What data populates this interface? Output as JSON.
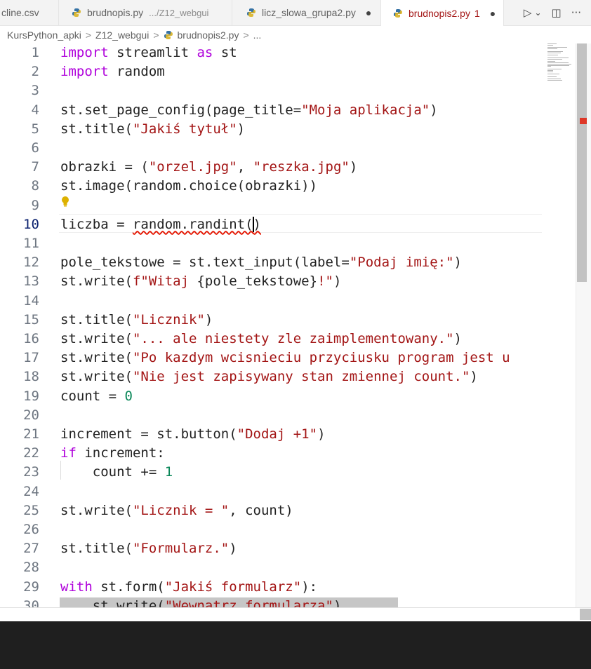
{
  "tabs": [
    {
      "name": "cline.csv",
      "active": false
    },
    {
      "name": "brudnopis.py",
      "desc": ".../Z12_webgui",
      "active": false
    },
    {
      "name": "licz_slowa_grupa2.py",
      "modified": true,
      "active": false
    },
    {
      "name": "brudnopis2.py",
      "problems": "1",
      "modified": true,
      "active": true
    }
  ],
  "tab_dot": "●",
  "actions": {
    "run": "▷",
    "run_menu": "⌄",
    "split": "◫",
    "more": "···"
  },
  "breadcrumb": [
    "KursPython_apki",
    "Z12_webgui",
    "brudnopis2.py",
    "..."
  ],
  "breadcrumb_sep": ">",
  "editor": {
    "current_line": 10,
    "lines": [
      {
        "n": "1",
        "tokens": [
          [
            "kw",
            "import"
          ],
          [
            "",
            " streamlit "
          ],
          [
            "kw",
            "as"
          ],
          [
            "",
            " st"
          ]
        ]
      },
      {
        "n": "2",
        "tokens": [
          [
            "kw",
            "import"
          ],
          [
            "",
            " random"
          ]
        ]
      },
      {
        "n": "3",
        "tokens": []
      },
      {
        "n": "4",
        "tokens": [
          [
            "",
            "st.set_page_config(page_title="
          ],
          [
            "str",
            "\"Moja aplikacja\""
          ],
          [
            "",
            ")"
          ]
        ]
      },
      {
        "n": "5",
        "tokens": [
          [
            "",
            "st.title("
          ],
          [
            "str",
            "\"Jakiś tytuł\""
          ],
          [
            "",
            ")"
          ]
        ]
      },
      {
        "n": "6",
        "tokens": []
      },
      {
        "n": "7",
        "tokens": [
          [
            "",
            "obrazki = ("
          ],
          [
            "str",
            "\"orzel.jpg\""
          ],
          [
            "",
            ", "
          ],
          [
            "str",
            "\"reszka.jpg\""
          ],
          [
            "",
            ")"
          ]
        ]
      },
      {
        "n": "8",
        "tokens": [
          [
            "",
            "st.image(random.choice(obrazki))"
          ]
        ]
      },
      {
        "n": "9",
        "tokens": []
      },
      {
        "n": "10",
        "tokens": [
          [
            "",
            "liczba = "
          ],
          [
            "sq",
            "random.randint("
          ],
          [
            "caret",
            ""
          ],
          [
            "sq",
            ")"
          ]
        ]
      },
      {
        "n": "11",
        "tokens": []
      },
      {
        "n": "12",
        "tokens": [
          [
            "",
            "pole_tekstowe = st.text_input(label="
          ],
          [
            "str",
            "\"Podaj imię:\""
          ],
          [
            "",
            ")"
          ]
        ]
      },
      {
        "n": "13",
        "tokens": [
          [
            "",
            "st.write("
          ],
          [
            "str",
            "f\"Witaj "
          ],
          [
            "",
            "{pole_tekstowe}"
          ],
          [
            "str",
            "!\""
          ],
          [
            "",
            ")"
          ]
        ]
      },
      {
        "n": "14",
        "tokens": []
      },
      {
        "n": "15",
        "tokens": [
          [
            "",
            "st.title("
          ],
          [
            "str",
            "\"Licznik\""
          ],
          [
            "",
            ")"
          ]
        ]
      },
      {
        "n": "16",
        "tokens": [
          [
            "",
            "st.write("
          ],
          [
            "str",
            "\"... ale niestety zle zaimplementowany.\""
          ],
          [
            "",
            ")"
          ]
        ]
      },
      {
        "n": "17",
        "tokens": [
          [
            "",
            "st.write("
          ],
          [
            "str",
            "\"Po kazdym wcisnieciu przyciusku program jest u"
          ]
        ]
      },
      {
        "n": "18",
        "tokens": [
          [
            "",
            "st.write("
          ],
          [
            "str",
            "\"Nie jest zapisywany stan zmiennej count.\""
          ],
          [
            "",
            ")"
          ]
        ]
      },
      {
        "n": "19",
        "tokens": [
          [
            "",
            "count = "
          ],
          [
            "num",
            "0"
          ]
        ]
      },
      {
        "n": "20",
        "tokens": []
      },
      {
        "n": "21",
        "tokens": [
          [
            "",
            "increment = st.button("
          ],
          [
            "str",
            "\"Dodaj +1\""
          ],
          [
            "",
            ")"
          ]
        ]
      },
      {
        "n": "22",
        "tokens": [
          [
            "kw",
            "if"
          ],
          [
            "",
            " increment:"
          ]
        ]
      },
      {
        "n": "23",
        "tokens": [
          [
            "",
            "    count += "
          ],
          [
            "num",
            "1"
          ]
        ]
      },
      {
        "n": "24",
        "tokens": []
      },
      {
        "n": "25",
        "tokens": [
          [
            "",
            "st.write("
          ],
          [
            "str",
            "\"Licznik = \""
          ],
          [
            "",
            ", count)"
          ]
        ]
      },
      {
        "n": "26",
        "tokens": []
      },
      {
        "n": "27",
        "tokens": [
          [
            "",
            "st.title("
          ],
          [
            "str",
            "\"Formularz.\""
          ],
          [
            "",
            ")"
          ]
        ]
      },
      {
        "n": "28",
        "tokens": []
      },
      {
        "n": "29",
        "tokens": [
          [
            "kw",
            "with"
          ],
          [
            "",
            " st.form("
          ],
          [
            "str",
            "\"Jakiś formularz\""
          ],
          [
            "",
            "):"
          ]
        ]
      },
      {
        "n": "30",
        "tokens": [
          [
            "",
            "    st.write("
          ],
          [
            "str",
            "\"Wewnatrz formularza\""
          ],
          [
            "",
            ")"
          ]
        ]
      }
    ]
  },
  "colors": {
    "keyword": "#af00db",
    "string": "#a31515",
    "number": "#098658",
    "error": "#e51400",
    "active_tab_text": "#a31515"
  }
}
